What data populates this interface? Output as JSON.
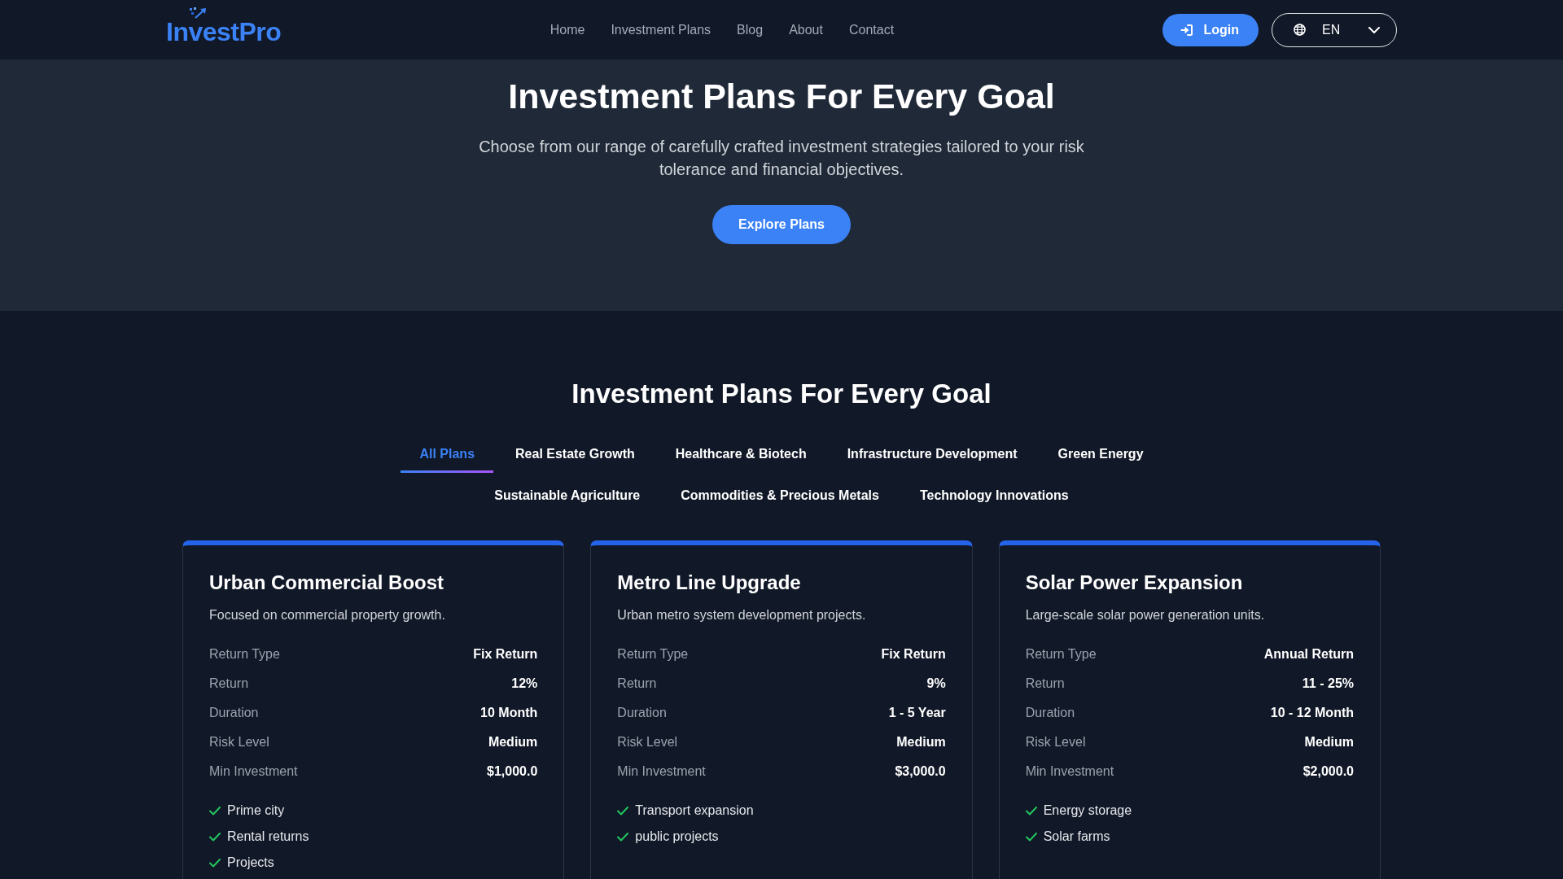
{
  "header": {
    "logo": "InvestPro",
    "nav": [
      "Home",
      "Investment Plans",
      "Blog",
      "About",
      "Contact"
    ],
    "login_button": "Login",
    "language": "EN"
  },
  "hero": {
    "title": "Investment Plans For Every Goal",
    "subtitle": "Choose from our range of carefully crafted investment strategies tailored to your risk tolerance and financial objectives.",
    "button": "Explore Plans"
  },
  "plans_section": {
    "title": "Investment Plans For Every Goal",
    "tabs": [
      {
        "label": "All Plans",
        "selected": true
      },
      {
        "label": "Real Estate Growth",
        "selected": false
      },
      {
        "label": "Healthcare & Biotech",
        "selected": false
      },
      {
        "label": "Infrastructure Development",
        "selected": false
      },
      {
        "label": "Green Energy",
        "selected": false
      },
      {
        "label": "Sustainable Agriculture",
        "selected": false
      },
      {
        "label": "Commodities & Precious Metals",
        "selected": false
      },
      {
        "label": "Technology Innovations",
        "selected": false
      }
    ],
    "cards": [
      {
        "title": "Urban Commercial Boost",
        "description": "Focused on commercial property growth.",
        "details": [
          {
            "label": "Return Type",
            "value": "Fix Return"
          },
          {
            "label": "Return",
            "value": "12%"
          },
          {
            "label": "Duration",
            "value": "10 Month"
          },
          {
            "label": "Risk Level",
            "value": "Medium"
          },
          {
            "label": "Min Investment",
            "value": "$1,000.0"
          }
        ],
        "features": [
          "Prime city",
          "Rental returns",
          "Projects"
        ]
      },
      {
        "title": "Metro Line Upgrade",
        "description": "Urban metro system development projects.",
        "details": [
          {
            "label": "Return Type",
            "value": "Fix Return"
          },
          {
            "label": "Return",
            "value": "9%"
          },
          {
            "label": "Duration",
            "value": "1 - 5 Year"
          },
          {
            "label": "Risk Level",
            "value": "Medium"
          },
          {
            "label": "Min Investment",
            "value": "$3,000.0"
          }
        ],
        "features": [
          "Transport expansion",
          "public projects"
        ]
      },
      {
        "title": "Solar Power Expansion",
        "description": "Large-scale solar power generation units.",
        "details": [
          {
            "label": "Return Type",
            "value": "Annual Return"
          },
          {
            "label": "Return",
            "value": "11 - 25%"
          },
          {
            "label": "Duration",
            "value": "10 - 12 Month"
          },
          {
            "label": "Risk Level",
            "value": "Medium"
          },
          {
            "label": "Min Investment",
            "value": "$2,000.0"
          }
        ],
        "features": [
          "Energy storage",
          "Solar farms"
        ]
      }
    ]
  }
}
